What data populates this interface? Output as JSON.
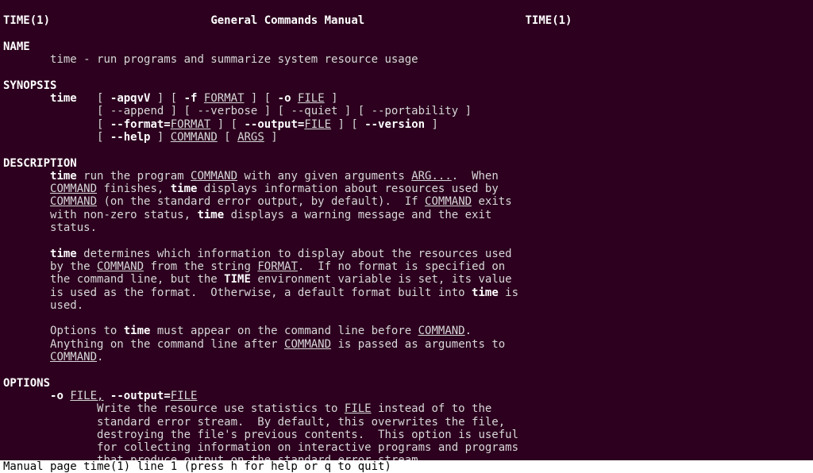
{
  "header": {
    "left": "TIME(1)",
    "center": "General Commands Manual",
    "right": "TIME(1)"
  },
  "name": {
    "heading": "NAME",
    "line": "time - run programs and summarize system resource usage"
  },
  "synopsis": {
    "heading": "SYNOPSIS",
    "cmd": "time",
    "l1": {
      "a": "   [ ",
      "flags": "-apqvV",
      "b": " ] [ ",
      "f": "-f",
      "c": " ",
      "format": "FORMAT",
      "d": " ] [ ",
      "o": "-o",
      "e": " ",
      "file": "FILE",
      "g": " ]"
    },
    "l2": "[ --append ] [ --verbose ] [ --quiet ] [ --portability ]",
    "l3": {
      "a": "[ ",
      "fmt": "--format=",
      "fmtu": "FORMAT",
      "b": " ] [ ",
      "out": "--output=",
      "outu": "FILE",
      "c": " ] [ ",
      "ver": "--version",
      "d": " ]"
    },
    "l4": {
      "a": "[ ",
      "help": "--help",
      "b": " ] ",
      "cmd": "COMMAND",
      "c": " [ ",
      "args": "ARGS",
      "d": " ]"
    }
  },
  "description": {
    "heading": "DESCRIPTION",
    "p1": {
      "t1": "time",
      "s1": " run the program ",
      "u1": "COMMAND",
      "s2": " with any given arguments ",
      "u2": "ARG...",
      "s3": ".  When",
      "u3": "COMMAND",
      "s4": " finishes, ",
      "t2": "time",
      "s5": " displays information about resources used by",
      "u4": "COMMAND",
      "s6": " (on the standard error output, by default).  If ",
      "u5": "COMMAND",
      "s7": " exits",
      "s8": "with non-zero status, ",
      "t3": "time",
      "s9": " displays a warning message and the exit",
      "s10": "status."
    },
    "p2": {
      "t1": "time",
      "s1": " determines which information to display about the resources used",
      "s2": "by the ",
      "u1": "COMMAND",
      "s3": " from the string ",
      "u2": "FORMAT",
      "s4": ".  If no format is specified on",
      "s5": "the command line, but the ",
      "t2": "TIME",
      "s6": " environment variable is set, its value",
      "s7": "is used as the format.  Otherwise, a default format built into ",
      "t3": "time",
      "s8": " is",
      "s9": "used."
    },
    "p3": {
      "s1": "Options to ",
      "t1": "time",
      "s2": " must appear on the command line before ",
      "u1": "COMMAND",
      "s3": ".",
      "s4": "Anything on the command line after ",
      "u2": "COMMAND",
      "s5": " is passed as arguments to",
      "u3": "COMMAND",
      "s6": "."
    }
  },
  "options": {
    "heading": "OPTIONS",
    "opt1": {
      "flag1": "-o",
      "sp": " ",
      "file1": "FILE,",
      "sp2": " ",
      "flag2": "--output=",
      "file2": "FILE",
      "d1": "Write the resource use statistics to ",
      "ufile": "FILE",
      "d1b": " instead of to the",
      "d2": "standard error stream.  By default, this overwrites the file,",
      "d3": "destroying the file's previous contents.  This option is useful",
      "d4": "for collecting information on interactive programs and programs",
      "d5": "that produce output on the standard error stream."
    }
  },
  "status": " Manual page time(1) line 1 (press h for help or q to quit)"
}
